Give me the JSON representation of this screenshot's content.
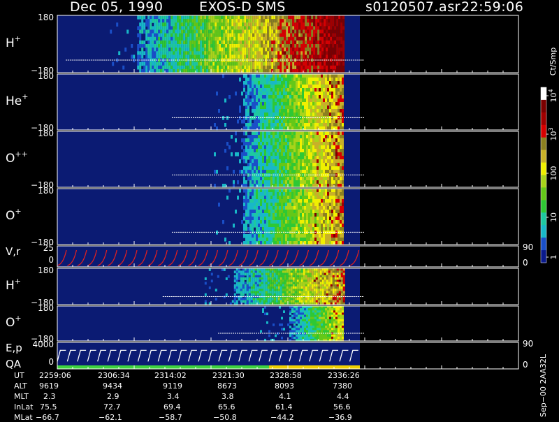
{
  "header": {
    "date": "Dec 05, 1990",
    "instrument": "EXOS-D SMS",
    "file": "s0120507.asr",
    "time": "22:59:06"
  },
  "colors": {
    "background": "#000000",
    "plot_background": "#0b1b73",
    "ramp": [
      "#0a1a8c",
      "#1a4fc8",
      "#18b8c8",
      "#1ec8a0",
      "#2ec834",
      "#64c818",
      "#a8d41a",
      "#f0f000",
      "#c8b028",
      "#8c8020",
      "#d80000",
      "#a00000",
      "#7a0000",
      "#ffffff"
    ]
  },
  "colorbar": {
    "unit_label": "Ct/Smp",
    "tick_labels": [
      "1",
      "10",
      "100",
      "10",
      "10"
    ],
    "tick_exponents": [
      "",
      "",
      "",
      "3",
      "4"
    ]
  },
  "ephemeris": {
    "row_labels": [
      "UT",
      "ALT",
      "MLT",
      "InLat",
      "MLat"
    ],
    "columns": [
      [
        "2259:06",
        "9619",
        "2.3",
        "75.5",
        "−66.7"
      ],
      [
        "2306:34",
        "9434",
        "2.9",
        "72.7",
        "−62.1"
      ],
      [
        "2314:02",
        "9119",
        "3.4",
        "69.4",
        "−58.7"
      ],
      [
        "2321:30",
        "8673",
        "3.8",
        "65.6",
        "−50.8"
      ],
      [
        "2328:58",
        "8093",
        "4.1",
        "61.4",
        "−44.2"
      ],
      [
        "2336:26",
        "7380",
        "4.4",
        "56.6",
        "−36.9"
      ]
    ]
  },
  "footer": {
    "version": "Sep−00 2AA32L"
  },
  "chart_data": [
    {
      "type": "heatmap",
      "panel": "H+ pitch angle",
      "label": "H",
      "label_sup": "+",
      "y_top_label": "180",
      "y_bottom_label": "−180",
      "ylim": [
        -180,
        180
      ],
      "x": [
        "2259:06",
        "2306:34",
        "2314:02",
        "2321:30",
        "2328:58",
        "2336:26"
      ],
      "onset_fraction": 0.17,
      "peak_level": "high",
      "data_end_fraction": 0.62
    },
    {
      "type": "heatmap",
      "panel": "He+ pitch angle",
      "label": "He",
      "label_sup": "+",
      "y_top_label": "180",
      "y_bottom_label": "−180",
      "ylim": [
        -180,
        180
      ],
      "onset_fraction": 0.4,
      "peak_level": "medium",
      "data_end_fraction": 0.62
    },
    {
      "type": "heatmap",
      "panel": "O++ pitch angle",
      "label": "O",
      "label_sup": "++",
      "y_top_label": "180",
      "y_bottom_label": "−180",
      "ylim": [
        -180,
        180
      ],
      "onset_fraction": 0.4,
      "peak_level": "medium",
      "data_end_fraction": 0.62
    },
    {
      "type": "heatmap",
      "panel": "O+ pitch angle",
      "label": "O",
      "label_sup": "+",
      "y_top_label": "180",
      "y_bottom_label": "−180",
      "ylim": [
        -180,
        180
      ],
      "onset_fraction": 0.4,
      "peak_level": "medium",
      "data_end_fraction": 0.62
    },
    {
      "type": "line",
      "panel": "V,r",
      "label": "V,r",
      "y_left_top": "25",
      "y_left_bottom": "0",
      "y_right_top": "90",
      "y_right_bottom": "0",
      "series": [
        {
          "pattern": "sawtooth",
          "cycles": 30
        }
      ]
    },
    {
      "type": "heatmap",
      "panel": "H+ lower",
      "label": "H",
      "label_sup": "+",
      "y_top_label": "180",
      "y_bottom_label": "−180",
      "ylim": [
        -180,
        180
      ],
      "onset_fraction": 0.38,
      "peak_level": "medium",
      "data_end_fraction": 0.62
    },
    {
      "type": "heatmap",
      "panel": "O+ lower",
      "label": "O",
      "label_sup": "+",
      "y_top_label": "180",
      "y_bottom_label": "−180",
      "ylim": [
        -180,
        180
      ],
      "onset_fraction": 0.5,
      "peak_level": "low",
      "data_end_fraction": 0.62
    },
    {
      "type": "line",
      "panel": "E,p / QA",
      "label": "E,p",
      "label2": "QA",
      "y_left_top": "4000",
      "y_left_bottom": "0",
      "y_right_top": "90",
      "y_right_bottom": "0",
      "series": [
        {
          "pattern": "staircase",
          "cycles": 30
        }
      ],
      "qa_bar": [
        "#3ed33e",
        "#f0d000"
      ]
    }
  ]
}
